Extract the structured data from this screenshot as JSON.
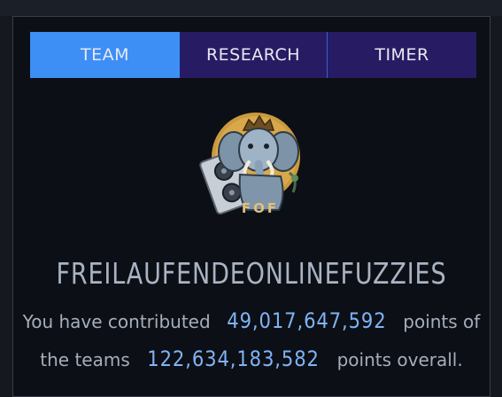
{
  "tabs": [
    {
      "label": "TEAM",
      "active": true
    },
    {
      "label": "RESEARCH",
      "active": false
    },
    {
      "label": "TIMER",
      "active": false
    }
  ],
  "logo": {
    "text": "FOF",
    "icon": "elephant-logo-icon"
  },
  "team": {
    "name": "FREILAUFENDEONLINEFUZZIES"
  },
  "stats": {
    "line1_prefix": "You have contributed",
    "contributed_points": "49,017,647,592",
    "line1_suffix": "points of",
    "line2_prefix": "the teams",
    "team_points": "122,634,183,582",
    "line2_suffix": "points overall."
  },
  "colors": {
    "accent_active_tab": "#3d8ff5",
    "inactive_tab": "#271c63",
    "number": "#7fb3f5",
    "background": "#0c0f15"
  }
}
